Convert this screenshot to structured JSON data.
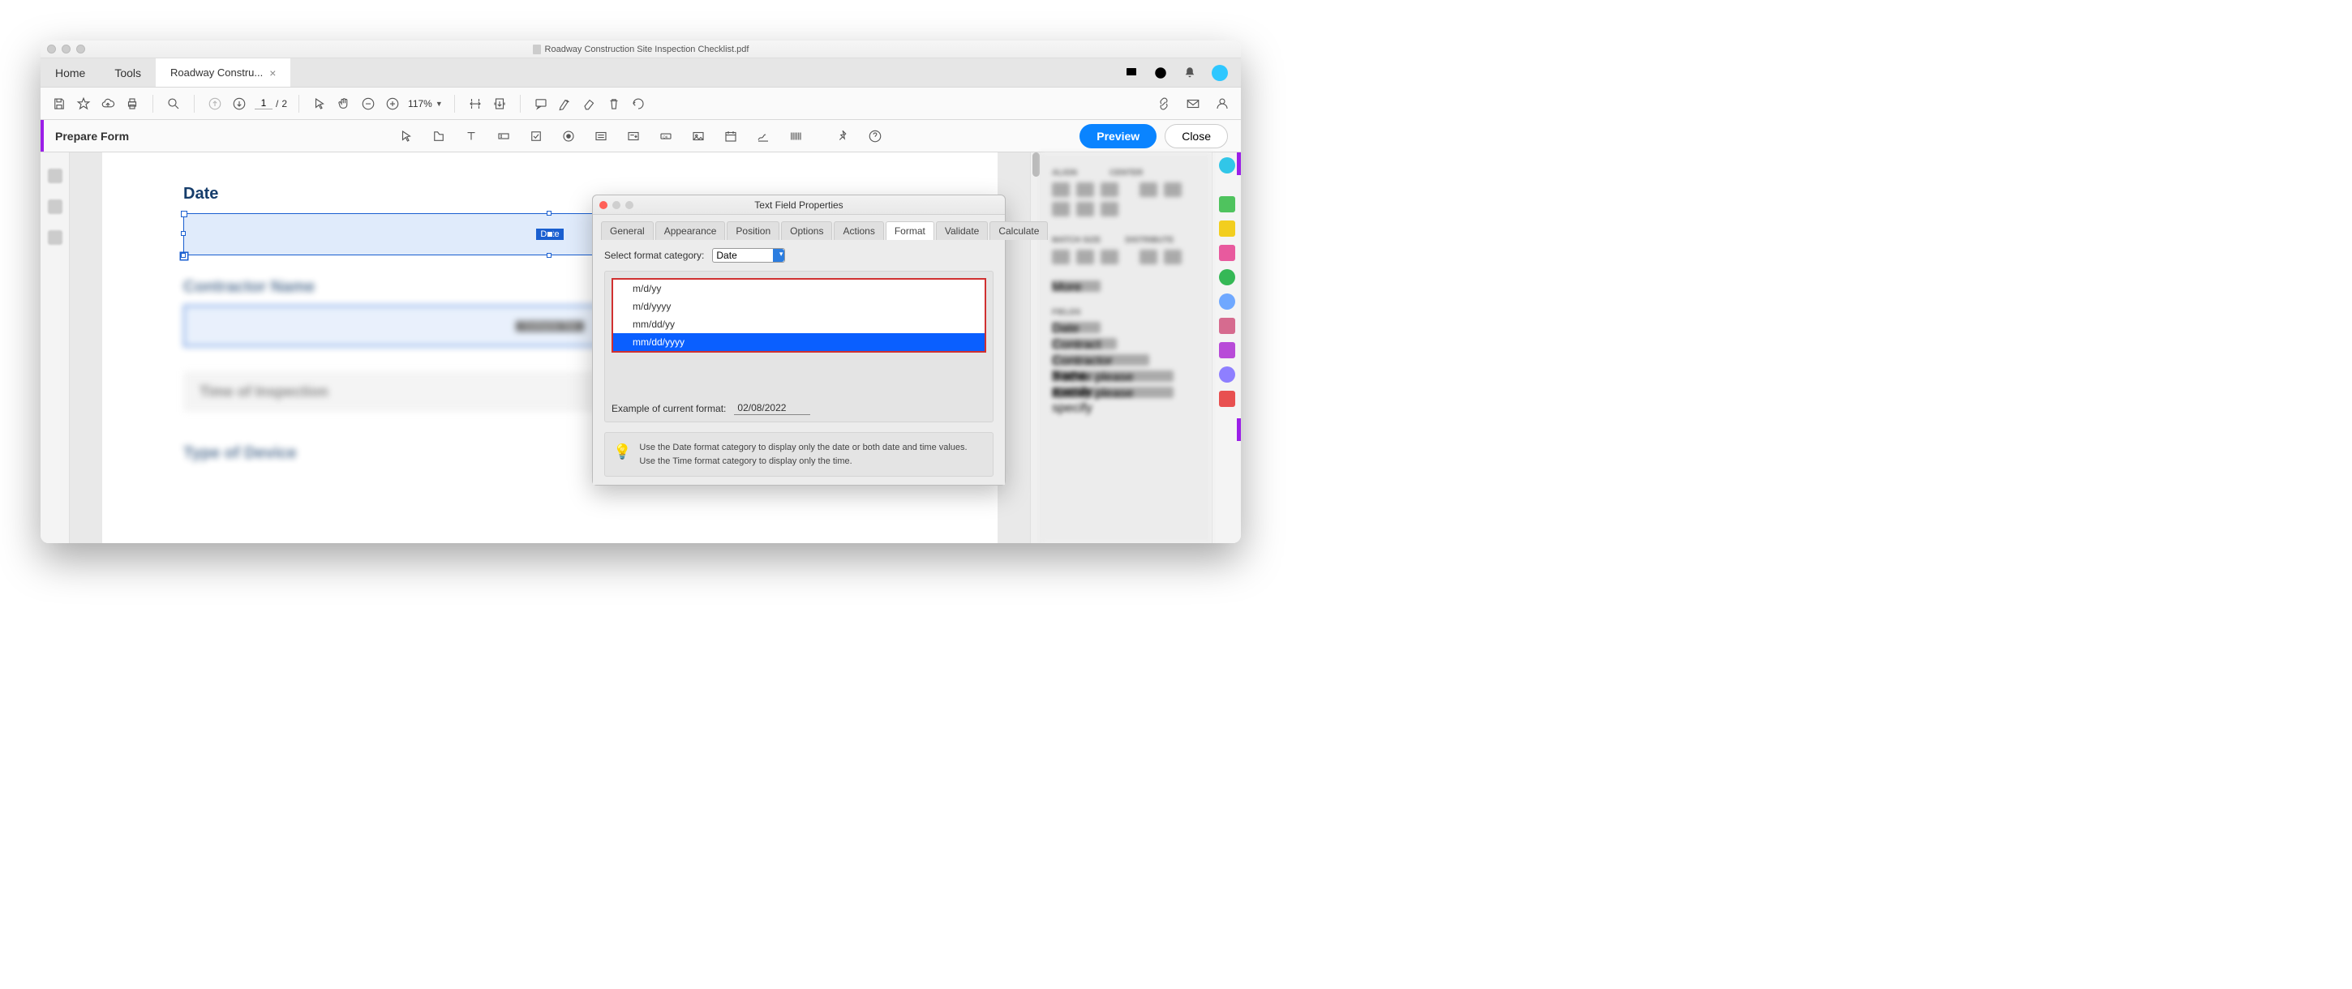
{
  "window_title": "Roadway Construction Site Inspection Checklist.pdf",
  "tabs": {
    "home": "Home",
    "tools": "Tools",
    "doc": "Roadway Constru...",
    "close": "×"
  },
  "toolbar": {
    "page_current": "1",
    "page_sep": "/",
    "page_total": "2",
    "zoom": "117%"
  },
  "prepare": {
    "label": "Prepare Form",
    "preview": "Preview",
    "close": "Close"
  },
  "page": {
    "date_label": "Date",
    "date_field_name": "Date",
    "contractor_label": "Contractor Name",
    "contractor_field": "Contractor Text",
    "time_label": "Time of Inspection",
    "device_label": "Type of Device"
  },
  "right_panel": {
    "align": "ALIGN",
    "center": "CENTER",
    "match": "MATCH SIZE",
    "dist": "DISTRIBUTE",
    "more": "More",
    "fields": "FIELDS",
    "f1": "Date",
    "f2": "Contract",
    "f3": "Contractor Name",
    "f4": "if other please specify",
    "f5": "if other please specify"
  },
  "dialog": {
    "title": "Text Field Properties",
    "tabs": [
      "General",
      "Appearance",
      "Position",
      "Options",
      "Actions",
      "Format",
      "Validate",
      "Calculate"
    ],
    "active_tab": "Format",
    "category_label": "Select format category:",
    "category_value": "Date",
    "options": [
      "m/d/yy",
      "m/d/yyyy",
      "mm/dd/yy",
      "mm/dd/yyyy"
    ],
    "selected_option": "mm/dd/yyyy",
    "example_label": "Example of current format:",
    "example_value": "02/08/2022",
    "hint": "Use the Date format category to display only the date or both date and time values. Use the Time format category to display only the time."
  }
}
